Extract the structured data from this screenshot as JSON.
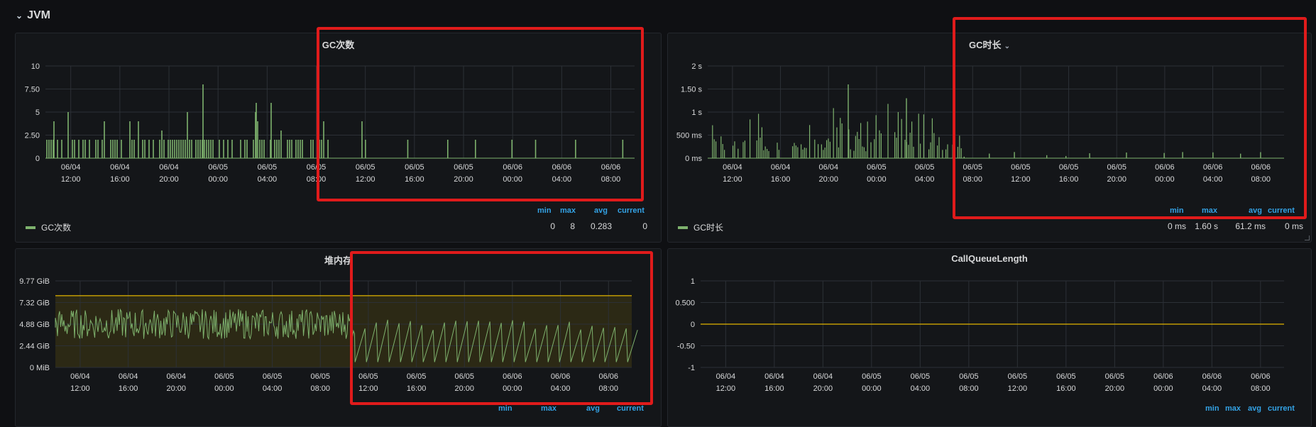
{
  "row": {
    "title": "JVM",
    "chevron_icon": "chevron-down-icon"
  },
  "x_ticks": [
    {
      "d": "06/04",
      "t": "12:00"
    },
    {
      "d": "06/04",
      "t": "16:00"
    },
    {
      "d": "06/04",
      "t": "20:00"
    },
    {
      "d": "06/05",
      "t": "00:00"
    },
    {
      "d": "06/05",
      "t": "04:00"
    },
    {
      "d": "06/05",
      "t": "08:00"
    },
    {
      "d": "06/05",
      "t": "12:00"
    },
    {
      "d": "06/05",
      "t": "16:00"
    },
    {
      "d": "06/05",
      "t": "20:00"
    },
    {
      "d": "06/06",
      "t": "00:00"
    },
    {
      "d": "06/06",
      "t": "04:00"
    },
    {
      "d": "06/06",
      "t": "08:00"
    }
  ],
  "colors": {
    "series": "#7eb26d",
    "threshold": "#e0b400",
    "highlight": "#e01b1b",
    "legend_head": "#33a2e5"
  },
  "panels": {
    "gc_count": {
      "title": "GC次数",
      "legend": {
        "headers": {
          "min": "min",
          "max": "max",
          "avg": "avg",
          "current": "current"
        },
        "series_name": "GC次数",
        "min": "0",
        "max": "8",
        "avg": "0.283",
        "current": "0"
      }
    },
    "gc_time": {
      "title": "GC时长",
      "caret_icon": "chevron-down-icon",
      "legend": {
        "headers": {
          "min": "min",
          "max": "max",
          "avg": "avg",
          "current": "current"
        },
        "series_name": "GC时长",
        "min": "0 ms",
        "max": "1.60 s",
        "avg": "61.2 ms",
        "current": "0 ms"
      }
    },
    "heap": {
      "title": "堆内存",
      "legend": {
        "headers": {
          "min": "min",
          "max": "max",
          "avg": "avg",
          "current": "current"
        }
      }
    },
    "call_queue": {
      "title": "CallQueueLength",
      "legend": {
        "headers": {
          "min": "min",
          "max": "max",
          "avg": "avg",
          "current": "current"
        }
      }
    }
  },
  "chart_data": [
    {
      "type": "bar",
      "title": "GC次数",
      "y_ticks": [
        "10",
        "7.50",
        "5",
        "2.50",
        "0"
      ],
      "ylim": [
        0,
        10
      ],
      "x_range": [
        "06/04 10:00",
        "06/06 10:00"
      ],
      "series": [
        {
          "name": "GC次数",
          "peak_values": [
            4,
            8,
            6,
            6,
            4,
            4,
            2,
            2,
            2,
            2,
            2,
            2
          ],
          "typical": 2,
          "after_06_05_10": "sparse 2"
        }
      ],
      "legend": {
        "min": 0,
        "max": 8,
        "avg": 0.283,
        "current": 0
      }
    },
    {
      "type": "bar",
      "title": "GC时长",
      "y_ticks": [
        "2 s",
        "1.50 s",
        "1 s",
        "500 ms",
        "0 ms"
      ],
      "ylim": [
        0,
        2
      ],
      "unit": "s",
      "series": [
        {
          "name": "GC时长",
          "peak": 1.6,
          "typical": 0.4,
          "after_06_05_12": "near 0"
        }
      ],
      "legend": {
        "min": "0 ms",
        "max": "1.60 s",
        "avg": "61.2 ms",
        "current": "0 ms"
      }
    },
    {
      "type": "line",
      "title": "堆内存",
      "y_ticks": [
        "9.77 GiB",
        "7.32 GiB",
        "4.88 GiB",
        "2.44 GiB",
        "0 MiB"
      ],
      "ylim": [
        0,
        9.77
      ],
      "unit": "GiB",
      "threshold": 8.1,
      "series": [
        {
          "name": "heap",
          "noisy_range_until_06_05_10": [
            3.2,
            6.6
          ],
          "sawtooth_after": [
            0.6,
            5.4
          ]
        }
      ]
    },
    {
      "type": "line",
      "title": "CallQueueLength",
      "y_ticks": [
        "1",
        "0.500",
        "0",
        "-0.50",
        "-1"
      ],
      "ylim": [
        -1,
        1
      ],
      "series": [
        {
          "name": "CallQueueLength",
          "values": [
            0,
            0
          ]
        }
      ]
    }
  ]
}
